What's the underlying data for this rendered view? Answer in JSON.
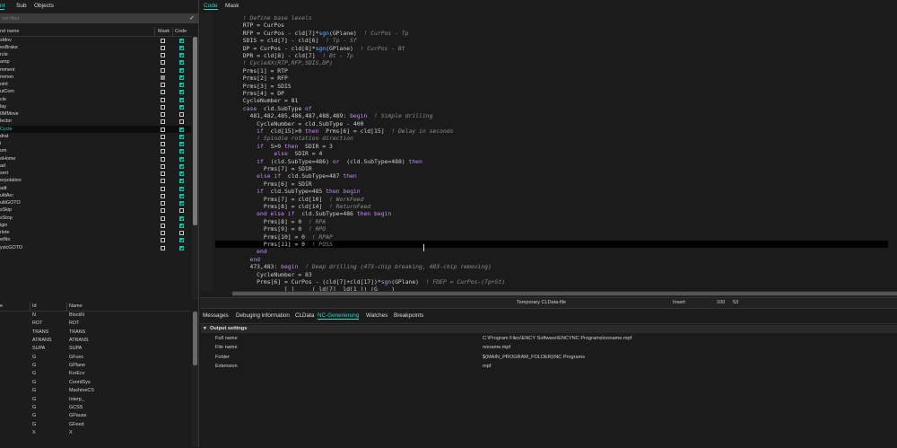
{
  "left_tabs": [
    {
      "label": "nt",
      "active": true
    },
    {
      "label": "Sub",
      "active": false
    },
    {
      "label": "Objects",
      "active": false
    }
  ],
  "filter": {
    "placeholder": "me filter",
    "icon": "check-icon"
  },
  "list1_header": {
    "name": "nd name",
    "mask": "Mask",
    "code": "Code"
  },
  "list1_rows": [
    {
      "name": "sMov",
      "mask": "off",
      "code": "on"
    },
    {
      "name": "esBrake",
      "mask": "off",
      "code": "on"
    },
    {
      "name": "rcle",
      "mask": "off",
      "code": "on"
    },
    {
      "name": "amp",
      "mask": "off",
      "code": "on"
    },
    {
      "name": "mment",
      "mask": "off",
      "code": "on"
    },
    {
      "name": "mmon",
      "mask": "gray",
      "code": "on"
    },
    {
      "name": "oint",
      "mask": "off",
      "code": "on"
    },
    {
      "name": "utCom",
      "mask": "off",
      "code": "on"
    },
    {
      "name": "cle",
      "mask": "off",
      "code": "on"
    },
    {
      "name": "lay",
      "mask": "off",
      "code": "on"
    },
    {
      "name": "0MMove",
      "mask": "off",
      "code": "off"
    },
    {
      "name": "lector",
      "mask": "off",
      "code": "off"
    },
    {
      "name": "Cycle",
      "mask": "off",
      "code": "on",
      "selected": true
    },
    {
      "name": "drat",
      "mask": "off",
      "code": "on"
    },
    {
      "name": "i",
      "mask": "off",
      "code": "on"
    },
    {
      "name": "om",
      "mask": "off",
      "code": "on"
    },
    {
      "name": "oHome",
      "mask": "off",
      "code": "on"
    },
    {
      "name": "ad",
      "mask": "off",
      "code": "on"
    },
    {
      "name": "sert",
      "mask": "off",
      "code": "on"
    },
    {
      "name": "erpolation",
      "mask": "off",
      "code": "on"
    },
    {
      "name": "adt",
      "mask": "off",
      "code": "on"
    },
    {
      "name": "ultiArc",
      "mask": "off",
      "code": "on"
    },
    {
      "name": "ultiGOTO",
      "mask": "off",
      "code": "on"
    },
    {
      "name": "sSkip",
      "mask": "off",
      "code": "off"
    },
    {
      "name": "sStop",
      "mask": "off",
      "code": "on"
    },
    {
      "name": "igin",
      "mask": "off",
      "code": "on"
    },
    {
      "name": "rlete",
      "mask": "off",
      "code": "off"
    },
    {
      "name": "etNo",
      "mask": "off",
      "code": "on"
    },
    {
      "name": "ysicGOTO",
      "mask": "off",
      "code": "on"
    }
  ],
  "list2_header": {
    "c1": "e",
    "c2": "Id",
    "c3": "Name"
  },
  "list2_rows": [
    {
      "c1": "",
      "c2": "N",
      "c3": "BlockN"
    },
    {
      "c1": "",
      "c2": "ROT",
      "c3": "ROT"
    },
    {
      "c1": "",
      "c2": "TRANS",
      "c3": "TRANS"
    },
    {
      "c1": "",
      "c2": "ATRANS",
      "c3": "ATRANS"
    },
    {
      "c1": "",
      "c2": "SUPA",
      "c3": "SUPA"
    },
    {
      "c1": "",
      "c2": "G",
      "c3": "GFunc"
    },
    {
      "c1": "",
      "c2": "G",
      "c3": "GPlane"
    },
    {
      "c1": "",
      "c2": "G",
      "c3": "KorEcv"
    },
    {
      "c1": "",
      "c2": "G",
      "c3": "CoordSys"
    },
    {
      "c1": "",
      "c2": "G",
      "c3": "MachineCS"
    },
    {
      "c1": "",
      "c2": "G",
      "c3": "Interp_"
    },
    {
      "c1": "",
      "c2": "G",
      "c3": "GCSS"
    },
    {
      "c1": "",
      "c2": "G",
      "c3": "GPause"
    },
    {
      "c1": "",
      "c2": "G",
      "c3": "GFeed"
    },
    {
      "c1": "",
      "c2": "X",
      "c3": "X"
    }
  ],
  "editor_tabs": [
    {
      "label": "Code",
      "active": true
    },
    {
      "label": "Mask",
      "active": false
    }
  ],
  "code_lines": [
    [
      [
        "cm",
        "        ! Define base levels"
      ]
    ],
    [
      [
        "",
        "        RTP = CurPos"
      ]
    ],
    [
      [
        "",
        "        RFP = CurPos - cld[7]*"
      ],
      [
        "fn",
        "sgn"
      ],
      [
        "",
        "(GPlane)  "
      ],
      [
        "cm",
        "! CurPos - Tp"
      ]
    ],
    [
      [
        "",
        "        SDIS = cld[7] - cld[6]  "
      ],
      [
        "cm",
        "! Tp - Sf"
      ]
    ],
    [
      [
        "",
        "        DP = CurPos - cld[8]*"
      ],
      [
        "fn",
        "sgn"
      ],
      [
        "",
        "(GPlane)  "
      ],
      [
        "cm",
        "! CurPos - Bt"
      ]
    ],
    [
      [
        "",
        "        DPR = cld[8] - cld[7]  "
      ],
      [
        "cm",
        "! Bt - Tp"
      ]
    ],
    [
      [
        "cm",
        "        ! CycleXX(RTP,RFP,SDIS,DP)"
      ]
    ],
    [
      [
        "",
        "        Prms[1] = RTP"
      ]
    ],
    [
      [
        "",
        "        Prms[2] = RFP"
      ]
    ],
    [
      [
        "",
        "        Prms[3] = SDIS"
      ]
    ],
    [
      [
        "",
        "        Prms[4] = DP"
      ]
    ],
    [
      [
        "",
        "        CycleNumber = 81"
      ]
    ],
    [
      [
        "kw",
        "        case"
      ],
      [
        "",
        "  cld.SubType "
      ],
      [
        "kw",
        "of"
      ]
    ],
    [
      [
        "",
        "          481,482,485,486,487,488,489: "
      ],
      [
        "kw",
        "begin"
      ],
      [
        "",
        "  "
      ],
      [
        "cm",
        "! Simple drilling"
      ]
    ],
    [
      [
        "",
        "            CycleNumber = cld.SubType - 400"
      ]
    ],
    [
      [
        "kw",
        "            if"
      ],
      [
        "",
        "  cld[15]>0 "
      ],
      [
        "kw",
        "then"
      ],
      [
        "",
        "  Prms[6] = cld[15]  "
      ],
      [
        "cm",
        "! Delay in seconds"
      ]
    ],
    [
      [
        "cm",
        "            ! Spindle rotation direction"
      ]
    ],
    [
      [
        "kw",
        "            if"
      ],
      [
        "",
        "  S>0 "
      ],
      [
        "kw",
        "then"
      ],
      [
        "",
        "  SDIR = 3"
      ]
    ],
    [
      [
        "kw",
        "                 else"
      ],
      [
        "",
        "  SDIR = 4"
      ]
    ],
    [
      [
        "kw",
        "            if"
      ],
      [
        "",
        "  (cld.SubType=486) "
      ],
      [
        "kw",
        "or"
      ],
      [
        "",
        "  (cld.SubType=488) "
      ],
      [
        "kw",
        "then"
      ]
    ],
    [
      [
        "",
        "              Prms[7] = SDIR"
      ]
    ],
    [
      [
        "kw",
        "            else if"
      ],
      [
        "",
        "  cld.SubType=487 "
      ],
      [
        "kw",
        "then"
      ]
    ],
    [
      [
        "",
        "              Prms[6] = SDIR"
      ]
    ],
    [
      [
        "kw",
        "            if"
      ],
      [
        "",
        "  cld.SubType=485 "
      ],
      [
        "kw",
        "then begin"
      ]
    ],
    [
      [
        "",
        "              Prms[7] = cld[10]  "
      ],
      [
        "cm",
        "! WorkFeed"
      ]
    ],
    [
      [
        "",
        "              Prms[8] = cld[14]  "
      ],
      [
        "cm",
        "! ReturnFeed"
      ]
    ],
    [
      [
        "kw",
        "            end else if"
      ],
      [
        "",
        "  cld.SubType=486 "
      ],
      [
        "kw",
        "then begin"
      ]
    ],
    [
      [
        "",
        "              Prms[8] = 0  "
      ],
      [
        "cm",
        "! RPA"
      ]
    ],
    [
      [
        "",
        "              Prms[9] = 0  "
      ],
      [
        "cm",
        "! RPO"
      ]
    ],
    [
      [
        "",
        "              Prms[10] = 0  "
      ],
      [
        "cm",
        "! RPAP"
      ]
    ],
    [
      [
        "",
        "              Prms[11] = 0  "
      ],
      [
        "cm",
        "! POSS"
      ]
    ],
    [
      [
        "kw",
        "            end"
      ]
    ],
    [
      [
        "kw",
        "          end"
      ]
    ],
    [
      [
        "",
        "          473,483: "
      ],
      [
        "kw",
        "begin"
      ],
      [
        "",
        "  "
      ],
      [
        "cm",
        "! Deep drilling (473-chip breaking, 483-chip removing)"
      ]
    ],
    [
      [
        "",
        "            CycleNumber = 83"
      ]
    ],
    [
      [
        "",
        "            Prms[6] = CurPos - (cld[7]+cld[17])*"
      ],
      [
        "fn",
        "sgn"
      ],
      [
        "",
        "(GPlane)  "
      ],
      [
        "cm",
        "! FDEP = CurPos-(Tp+St)"
      ]
    ],
    [
      [
        "",
        "                    [ ]     ( ld[7]  ld[1 ]) (G    )"
      ]
    ]
  ],
  "status_bar": {
    "file": "Temporary CLData-file",
    "mode": "Insert",
    "line": "100",
    "col": "53"
  },
  "bottom_tabs": [
    {
      "label": "Messages",
      "active": false
    },
    {
      "label": "Debuging information",
      "active": false
    },
    {
      "label": "CLData",
      "active": false
    },
    {
      "label": "NC-Generierung",
      "active": true
    },
    {
      "label": "Watches",
      "active": false
    },
    {
      "label": "Breakpoints",
      "active": false
    }
  ],
  "output": {
    "section": "Output settings",
    "rows": [
      {
        "label": "Full name",
        "value": "C:\\Program Files\\ENCY Software\\ENCYNC Programs\\noname.mpf"
      },
      {
        "label": "File name",
        "value": "noname.mpf"
      },
      {
        "label": "Folder",
        "value": "$(MAIN_PROGRAM_FOLDER)\\NC Programs"
      },
      {
        "label": "Extension",
        "value": "mpf"
      }
    ]
  },
  "colors": {
    "accent": "#2dd4c6",
    "keyword": "#c58af9",
    "function": "#6fb2ff",
    "comment": "#8d8d8d",
    "checkbox_on": "#1fc2a5"
  }
}
